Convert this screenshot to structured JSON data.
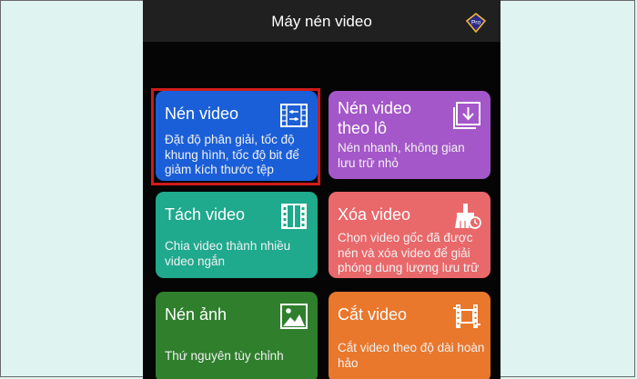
{
  "header": {
    "title": "Máy nén video",
    "pro_badge": "Pro"
  },
  "cards": [
    {
      "title": "Nén video",
      "description": "Đặt độ phân giải, tốc độ khung hình, tốc độ bit để giảm kích thước tệp",
      "icon": "film-settings-icon",
      "color": "#1a5fd8"
    },
    {
      "title": "Nén video theo lô",
      "description": "Nén nhanh, không gian lưu trữ nhỏ",
      "icon": "batch-download-icon",
      "color": "#a457c8"
    },
    {
      "title": "Tách video",
      "description": "Chia video thành nhiều video ngắn",
      "icon": "film-strip-icon",
      "color": "#1fa98d"
    },
    {
      "title": "Xóa video",
      "description": "Chọn video gốc đã được nén và xóa video để giải phóng dung lượng lưu trữ",
      "icon": "broom-clock-icon",
      "color": "#e9686a"
    },
    {
      "title": "Nén ảnh",
      "description": "Thứ nguyên tùy chỉnh",
      "icon": "image-icon",
      "color": "#2f7f2d"
    },
    {
      "title": "Cắt video",
      "description": "Cắt video theo độ dài hoàn hảo",
      "icon": "trim-video-icon",
      "color": "#e9772c"
    }
  ],
  "highlight_color": "#d11a1a"
}
